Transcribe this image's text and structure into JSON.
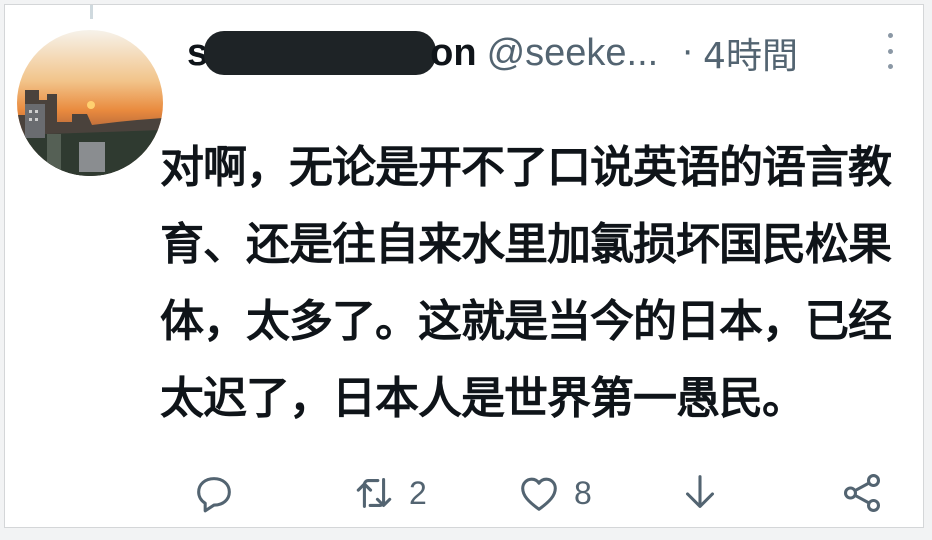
{
  "tweet": {
    "name_prefix": "s",
    "name_suffix": "on",
    "handle": "@seeke...",
    "separator": "·",
    "time": "4時間",
    "text": "对啊，无论是开不了口说英语的语言教\n育、还是往自来水里加氯损坏国民松果\n体，太多了。这就是当今的日本，已经\n太迟了，日本人是世界第一愚民。"
  },
  "actions": {
    "reply_icon": "speech-bubble-icon",
    "retweet_icon": "retweet-icon",
    "retweet_count": "2",
    "like_icon": "heart-icon",
    "like_count": "8",
    "bookmark_icon": "download-arrow-icon",
    "share_icon": "share-icon"
  },
  "colors": {
    "text_primary": "#0f1419",
    "text_secondary": "#536471",
    "redaction": "#1e2326"
  }
}
